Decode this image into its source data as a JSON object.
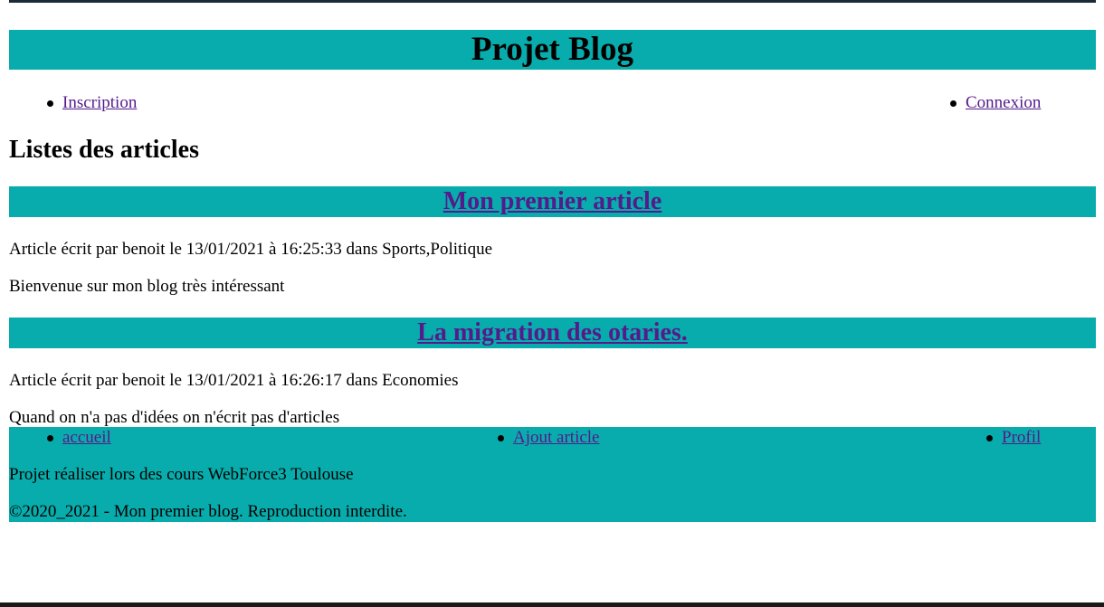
{
  "header": {
    "title": "Projet Blog"
  },
  "top_nav": {
    "inscription": "Inscription",
    "connexion": "Connexion"
  },
  "main": {
    "heading": "Listes des articles",
    "articles": [
      {
        "title": "Mon premier article",
        "meta": "Article écrit par benoit le 13/01/2021 à 16:25:33 dans Sports,Politique",
        "body": "Bienvenue sur mon blog très intéressant"
      },
      {
        "title": "La migration des otaries.",
        "meta": "Article écrit par benoit le 13/01/2021 à 16:26:17 dans Economies",
        "body": "Quand on n'a pas d'idées on n'écrit pas d'articles"
      }
    ]
  },
  "footer": {
    "nav": {
      "accueil": "accueil",
      "ajout_article": "Ajout article",
      "profil": "Profil"
    },
    "credits": "Projet réaliser lors des cours WebForce3 Toulouse",
    "copyright": "©2020_2021 - Mon premier blog. Reproduction interdite."
  },
  "colors": {
    "accent": "#09acac",
    "link": "#551a8b"
  }
}
